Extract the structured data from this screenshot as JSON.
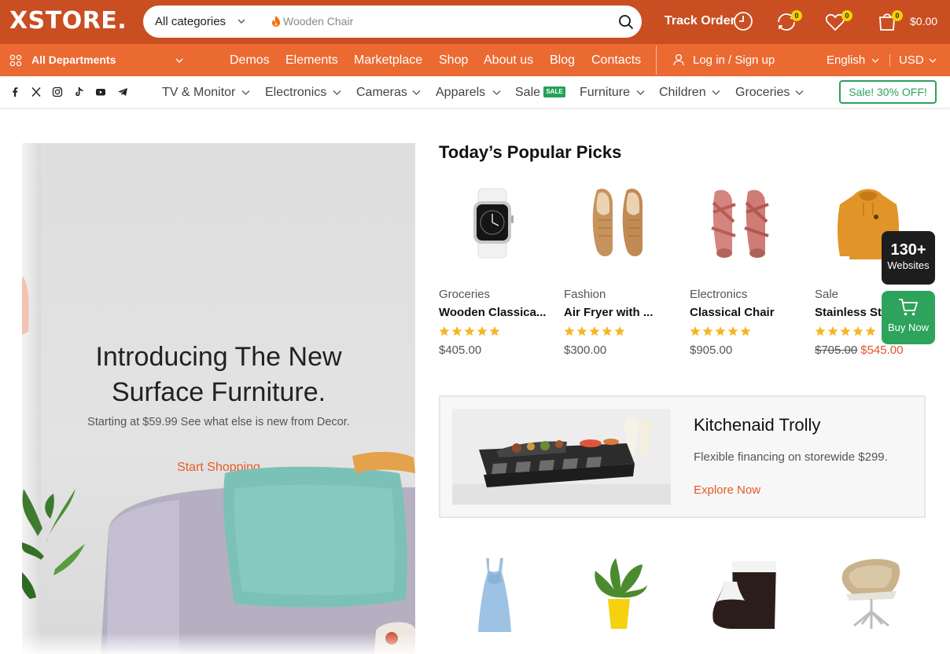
{
  "header": {
    "logo": "XSTORE.",
    "search": {
      "category": "All categories",
      "placeholder": "Wooden Chair"
    },
    "track_order": "Track Order",
    "compare_count": "0",
    "wishlist_count": "0",
    "cart_count": "0",
    "cart_total": "$0.00",
    "accent_color": "#c94e22"
  },
  "nav": {
    "departments": "All Departments",
    "items": [
      "Demos",
      "Elements",
      "Marketplace",
      "Shop",
      "About us",
      "Blog",
      "Contacts"
    ],
    "login": "Log in / Sign up",
    "language": "English",
    "currency": "USD",
    "bar_color": "#ea6a32"
  },
  "social": [
    "facebook-icon",
    "x-icon",
    "instagram-icon",
    "tiktok-icon",
    "youtube-icon",
    "telegram-icon"
  ],
  "categories": {
    "items": [
      "TV & Monitor",
      "Electronics",
      "Cameras",
      "Apparels",
      "Sale",
      "Furniture",
      "Children",
      "Groceries"
    ],
    "sale_tag": "SALE",
    "sale_button": "Sale! 30% OFF!"
  },
  "hero": {
    "title_line1": "Introducing The New",
    "title_line2": "Surface Furniture.",
    "subtitle": "Starting at $59.99 See what else is new from Decor.",
    "cta": "Start Shopping"
  },
  "popular": {
    "title": "Today’s Popular Picks",
    "products": [
      {
        "category": "Groceries",
        "name": "Wooden Classica...",
        "rating": 5,
        "price": "$405.00",
        "image": "smartwatch"
      },
      {
        "category": "Fashion",
        "name": "Air Fryer with ...",
        "rating": 5,
        "price": "$300.00",
        "image": "loafers"
      },
      {
        "category": "Electronics",
        "name": "Classical Chair",
        "rating": 5,
        "price": "$905.00",
        "image": "sandals"
      },
      {
        "category": "Sale",
        "name": "Stainless Ste",
        "rating": 5,
        "old_price": "$705.00",
        "price": "$545.00",
        "image": "hoodie"
      }
    ],
    "second_row": [
      "dress",
      "plant",
      "vase",
      "armchair"
    ]
  },
  "floating": {
    "sites_count": "130+",
    "sites_label": "Websites",
    "buy_label": "Buy Now"
  },
  "promo": {
    "title": "Kitchenaid Trolly",
    "description": "Flexible financing on storewide $299.",
    "cta": "Explore Now"
  }
}
